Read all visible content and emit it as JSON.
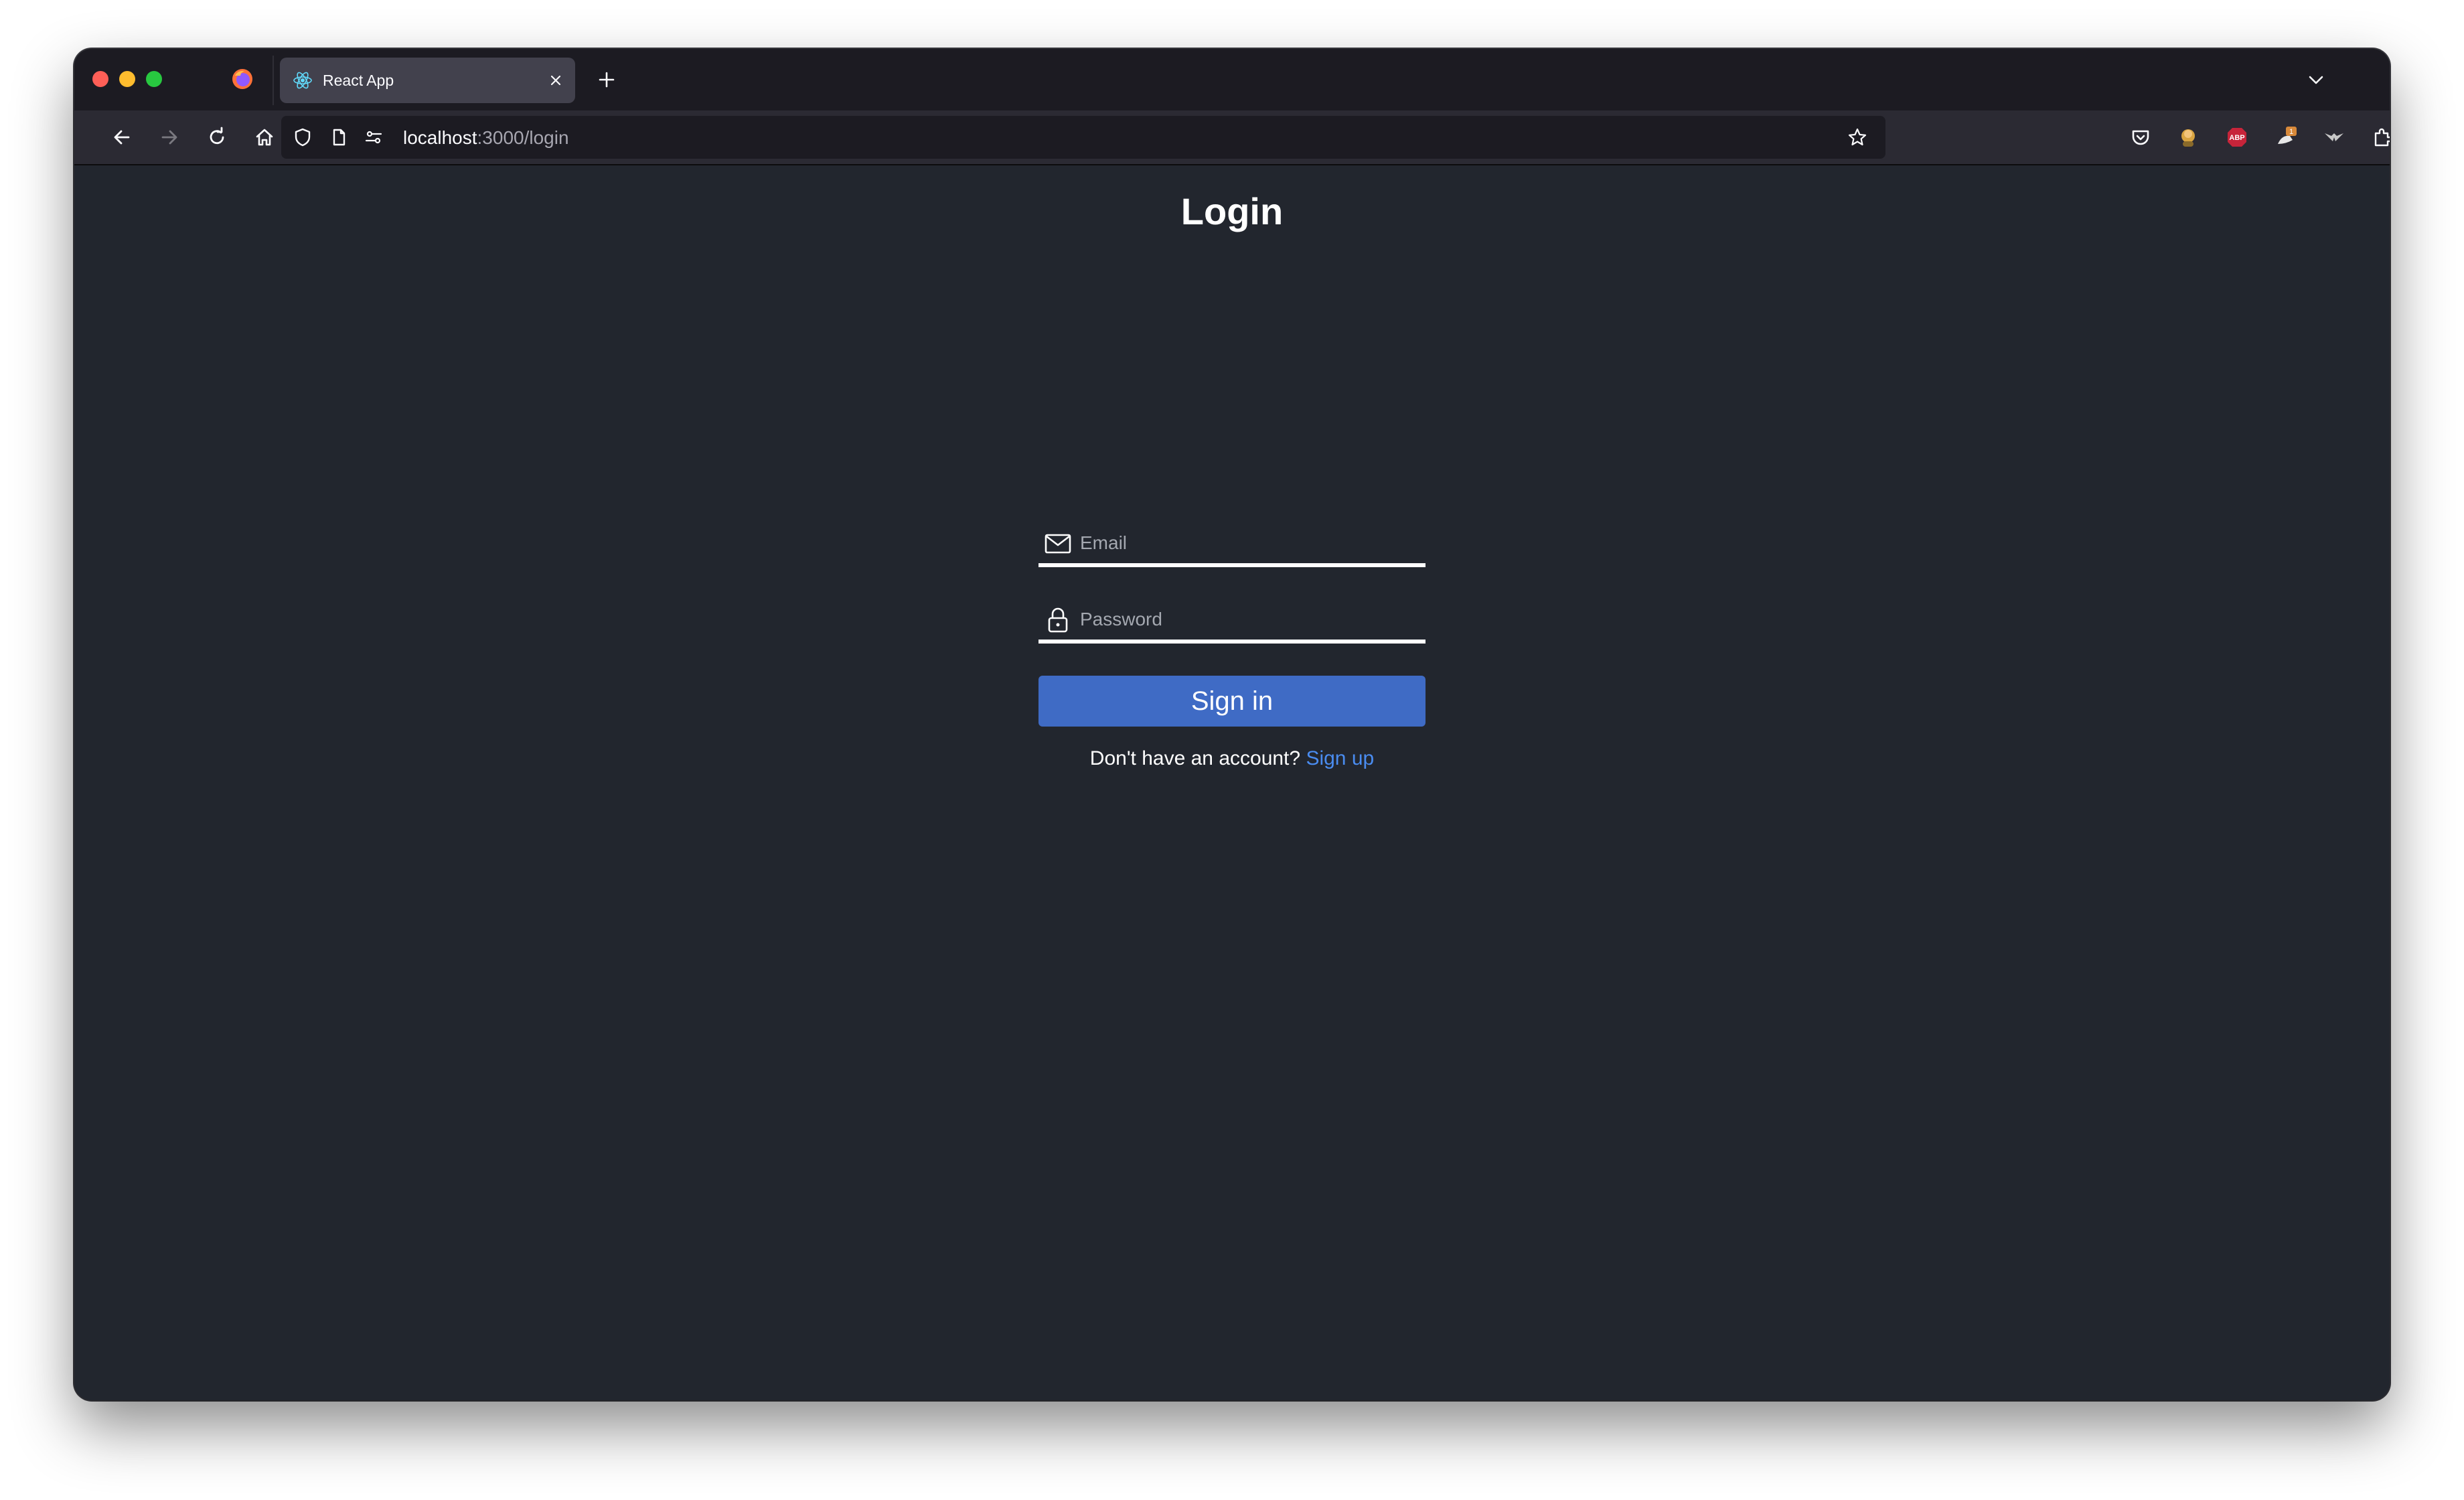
{
  "browser": {
    "tab": {
      "title": "React App",
      "favicon": "react-icon"
    },
    "url": {
      "host": "localhost",
      "path": ":3000/login"
    },
    "icons": {
      "back": "back-arrow-icon",
      "forward": "forward-arrow-icon",
      "reload": "reload-icon",
      "home": "home-icon",
      "shield": "tracking-shield-icon",
      "page": "page-icon",
      "permissions": "permissions-icon",
      "bookmark": "bookmark-star-icon",
      "pocket": "pocket-icon",
      "extensions": "extensions-icon",
      "menu": "hamburger-menu-icon"
    },
    "extension_badges": {
      "adblock": "ABP",
      "notification_count": "1"
    }
  },
  "page": {
    "title": "Login",
    "email": {
      "placeholder": "Email",
      "value": "",
      "icon": "envelope-icon"
    },
    "password": {
      "placeholder": "Password",
      "value": "",
      "icon": "lock-icon"
    },
    "submit_label": "Sign in",
    "signup_prompt": "Don't have an account?",
    "signup_link": "Sign up"
  },
  "colors": {
    "page_background": "#22262e",
    "primary_button": "#3f6bc5",
    "link": "#4a8cf0",
    "tabstrip": "#1c1b22",
    "navbar": "#2b2a33"
  }
}
